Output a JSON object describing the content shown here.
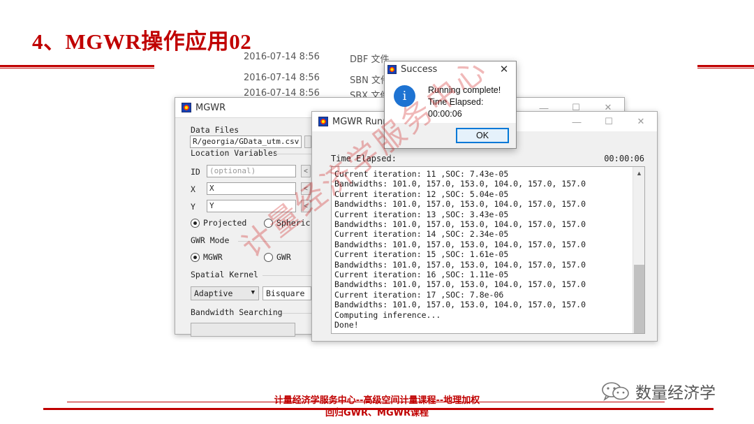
{
  "slide": {
    "title": "4、MGWR操作应用02",
    "footer_line1": "计量经济学服务中心--高级空间计量课程--地理加权",
    "footer_line2": "回归GWR、MGWR课程",
    "logo_text": "数量经济学",
    "watermark": "计量经济学服务中心",
    "accent_color": "#c00000"
  },
  "background_files": [
    {
      "date": "2016-07-14 8:56",
      "type": "DBF 文件"
    },
    {
      "date": "2016-07-14 8:56",
      "type": "SBN 文件"
    },
    {
      "date": "2016-07-14 8:56",
      "type": "SBX 文件"
    }
  ],
  "mgwr_window": {
    "title": "MGWR",
    "data_files_label": "Data Files",
    "data_file_value": "R/georgia/GData_utm.csv",
    "location_label": "Location Variables",
    "id_label": "ID",
    "id_placeholder": "(optional)",
    "x_label": "X",
    "x_value": "X",
    "y_label": "Y",
    "y_value": "Y",
    "projected_label": "Projected",
    "spherical_label": "Spheric",
    "gwr_mode_label": "GWR Mode",
    "mgwr_option": "MGWR",
    "gwr_option": "GWR",
    "kernel_label": "Spatial Kernel",
    "kernel_type": "Adaptive",
    "kernel_func": "Bisquare",
    "bandwidth_label": "Bandwidth Searching",
    "arrow": "<"
  },
  "run_window": {
    "title": "MGWR Runn",
    "elapsed_label": "Time Elapsed:",
    "elapsed_value": "00:00:06",
    "log": [
      "Current iteration: 11 ,SOC: 7.43e-05",
      "Bandwidths: 101.0, 157.0, 153.0, 104.0, 157.0, 157.0",
      "Current iteration: 12 ,SOC: 5.04e-05",
      "Bandwidths: 101.0, 157.0, 153.0, 104.0, 157.0, 157.0",
      "Current iteration: 13 ,SOC: 3.43e-05",
      "Bandwidths: 101.0, 157.0, 153.0, 104.0, 157.0, 157.0",
      "Current iteration: 14 ,SOC: 2.34e-05",
      "Bandwidths: 101.0, 157.0, 153.0, 104.0, 157.0, 157.0",
      "Current iteration: 15 ,SOC: 1.61e-05",
      "Bandwidths: 101.0, 157.0, 153.0, 104.0, 157.0, 157.0",
      "Current iteration: 16 ,SOC: 1.11e-05",
      "Bandwidths: 101.0, 157.0, 153.0, 104.0, 157.0, 157.0",
      "Current iteration: 17 ,SOC: 7.8e-06",
      "Bandwidths: 101.0, 157.0, 153.0, 104.0, 157.0, 157.0",
      "Computing inference...",
      "Done!"
    ]
  },
  "success_dialog": {
    "title": "Success",
    "message_1": "Running complete!",
    "message_2": "Time Elapsed:",
    "message_3": "00:00:06",
    "ok_label": "OK",
    "info_glyph": "i",
    "close_glyph": "✕"
  },
  "window_controls": {
    "minimize": "—",
    "maximize": "☐",
    "close": "✕"
  },
  "icons": [
    "mgwr-app-icon",
    "info-icon",
    "close-icon",
    "chevron-down-icon",
    "scroll-up-icon",
    "wechat-logo-icon"
  ]
}
